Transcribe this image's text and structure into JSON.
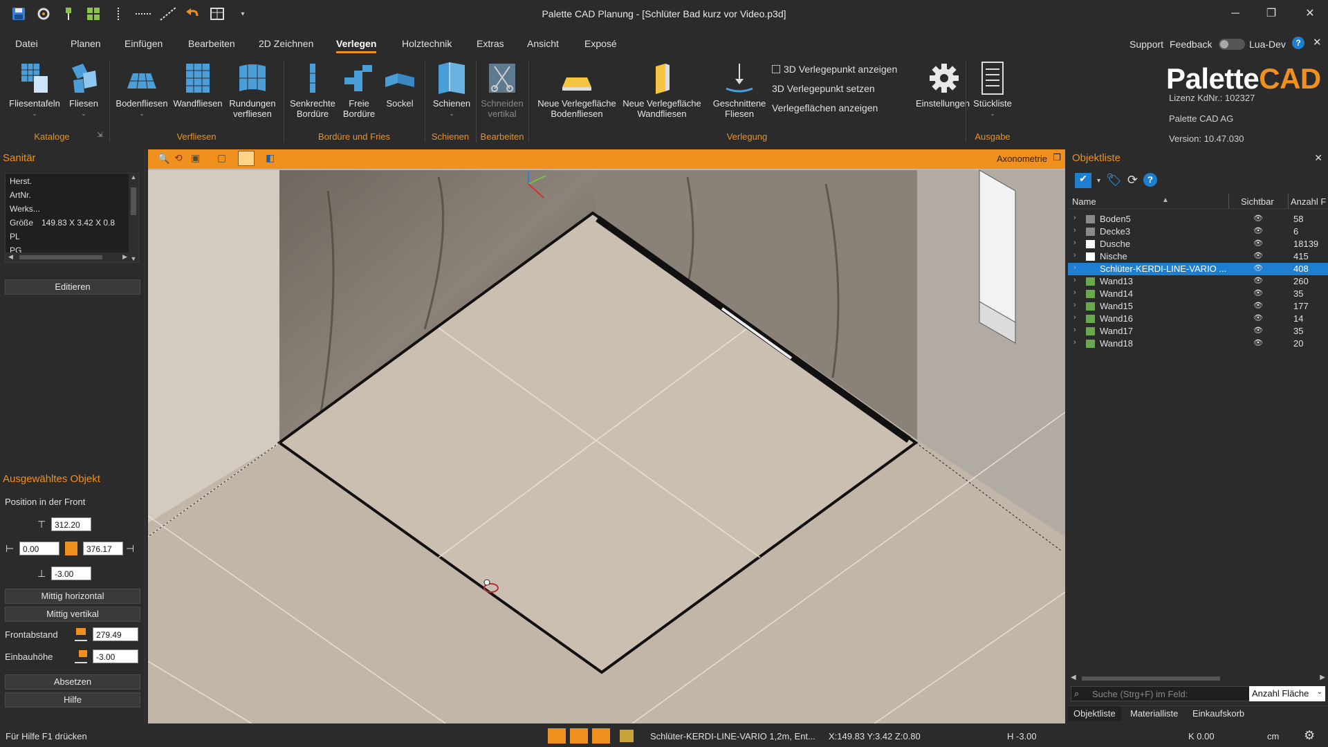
{
  "title_bar": {
    "title": "Palette CAD Planung - [Schlüter Bad kurz vor Video.p3d]"
  },
  "menu": {
    "tabs": [
      "Datei",
      "Planen",
      "Einfügen",
      "Bearbeiten",
      "2D Zeichnen",
      "Verlegen",
      "Holztechnik",
      "Extras",
      "Ansicht",
      "Exposé"
    ],
    "active_tab": "Verlegen",
    "support": "Support",
    "feedback": "Feedback",
    "lua_dev": "Lua-Dev"
  },
  "ribbon": {
    "buttons": {
      "fliesentafeln": "Fliesentafeln",
      "fliesen": "Fliesen",
      "bodenfliesen": "Bodenfliesen",
      "wandfliesen": "Wandfliesen",
      "rundungen_1": "Rundungen",
      "rundungen_2": "verfliesen",
      "senkrechte_1": "Senkrechte",
      "senkrechte_2": "Bordüre",
      "freie_1": "Freie",
      "freie_2": "Bordüre",
      "sockel": "Sockel",
      "schienen": "Schienen",
      "schneiden_1": "Schneiden",
      "schneiden_2": "vertikal",
      "neue_boden_1": "Neue Verlegefläche",
      "neue_boden_2": "Bodenfliesen",
      "neue_wand_1": "Neue Verlegefläche",
      "neue_wand_2": "Wandfliesen",
      "geschnittene_1": "Geschnittene",
      "geschnittene_2": "Fliesen",
      "einstellungen": "Einstellungen",
      "stueckliste": "Stückliste"
    },
    "checks": {
      "verlegepunkt_anzeigen": "3D Verlegepunkt anzeigen",
      "verlegepunkt_setzen": "3D Verlegepunkt setzen",
      "verlegeflaechen": "Verlegeflächen anzeigen"
    },
    "groups": {
      "kataloge": "Kataloge",
      "verfliesen": "Verfliesen",
      "bordure": "Bordüre und Fries",
      "schienen": "Schienen",
      "bearbeiten": "Bearbeiten",
      "verlegung": "Verlegung",
      "ausgabe": "Ausgabe"
    }
  },
  "brand": {
    "name_a": "Palette",
    "name_b": "CAD",
    "lizenz": "Lizenz KdNr.: 102327",
    "company": "Palette CAD AG",
    "version": "Version: 10.47.030"
  },
  "left_panel": {
    "title": "Sanitär",
    "fields": [
      {
        "k": "Herst.",
        "v": ""
      },
      {
        "k": "ArtNr.",
        "v": ""
      },
      {
        "k": "Werks...",
        "v": ""
      },
      {
        "k": "Größe",
        "v": "149.83 X 3.42 X 0.8"
      },
      {
        "k": "PL",
        "v": ""
      },
      {
        "k": "PG",
        "v": ""
      }
    ],
    "edit_button": "Editieren",
    "selected_title": "Ausgewähltes Objekt",
    "position_label": "Position in der Front",
    "top_value": "312.20",
    "left_value": "0.00",
    "width_value": "376.17",
    "bottom_value": "-3.00",
    "btn_mittig_h": "Mittig horizontal",
    "btn_mittig_v": "Mittig vertikal",
    "frontabstand_label": "Frontabstand",
    "frontabstand_value": "279.49",
    "einbauhoehe_label": "Einbauhöhe",
    "einbauhoehe_value": "-3.00",
    "btn_absetzen": "Absetzen",
    "btn_hilfe": "Hilfe"
  },
  "viewport": {
    "view_name": "Axonometrie"
  },
  "object_list": {
    "title": "Objektliste",
    "columns": {
      "name": "Name",
      "visible": "Sichtbar",
      "count": "Anzahl F"
    },
    "items": [
      {
        "name": "Boden5",
        "count": "58",
        "icon_color": "#8a8a8a"
      },
      {
        "name": "Decke3",
        "count": "6",
        "icon_color": "#8a8a8a"
      },
      {
        "name": "Dusche",
        "count": "18139",
        "icon_color": "#ffffff"
      },
      {
        "name": "Nische",
        "count": "415",
        "icon_color": "#ffffff"
      },
      {
        "name": "Schlüter-KERDI-LINE-VARIO ...",
        "count": "408",
        "icon_color": "#1e7fd0"
      },
      {
        "name": "Wand13",
        "count": "260",
        "icon_color": "#6aa84f"
      },
      {
        "name": "Wand14",
        "count": "35",
        "icon_color": "#6aa84f"
      },
      {
        "name": "Wand15",
        "count": "177",
        "icon_color": "#6aa84f"
      },
      {
        "name": "Wand16",
        "count": "14",
        "icon_color": "#6aa84f"
      },
      {
        "name": "Wand17",
        "count": "35",
        "icon_color": "#6aa84f"
      },
      {
        "name": "Wand18",
        "count": "20",
        "icon_color": "#6aa84f"
      }
    ],
    "selected_index": 4,
    "search_placeholder": "Suche (Strg+F) im Feld:",
    "search_field": "Anzahl Fläche",
    "tabs": [
      "Objektliste",
      "Materialliste",
      "Einkaufskorb"
    ]
  },
  "status_bar": {
    "help": "Für Hilfe F1 drücken",
    "object": "Schlüter-KERDI-LINE-VARIO 1,2m, Ent...",
    "coords": "X:149.83  Y:3.42  Z:0.80",
    "height": "H -3.00",
    "k": "K 0.00",
    "unit": "cm"
  },
  "colors": {
    "accent": "#f0901e",
    "selection": "#1e7fd0",
    "background": "#2b2b2b"
  }
}
